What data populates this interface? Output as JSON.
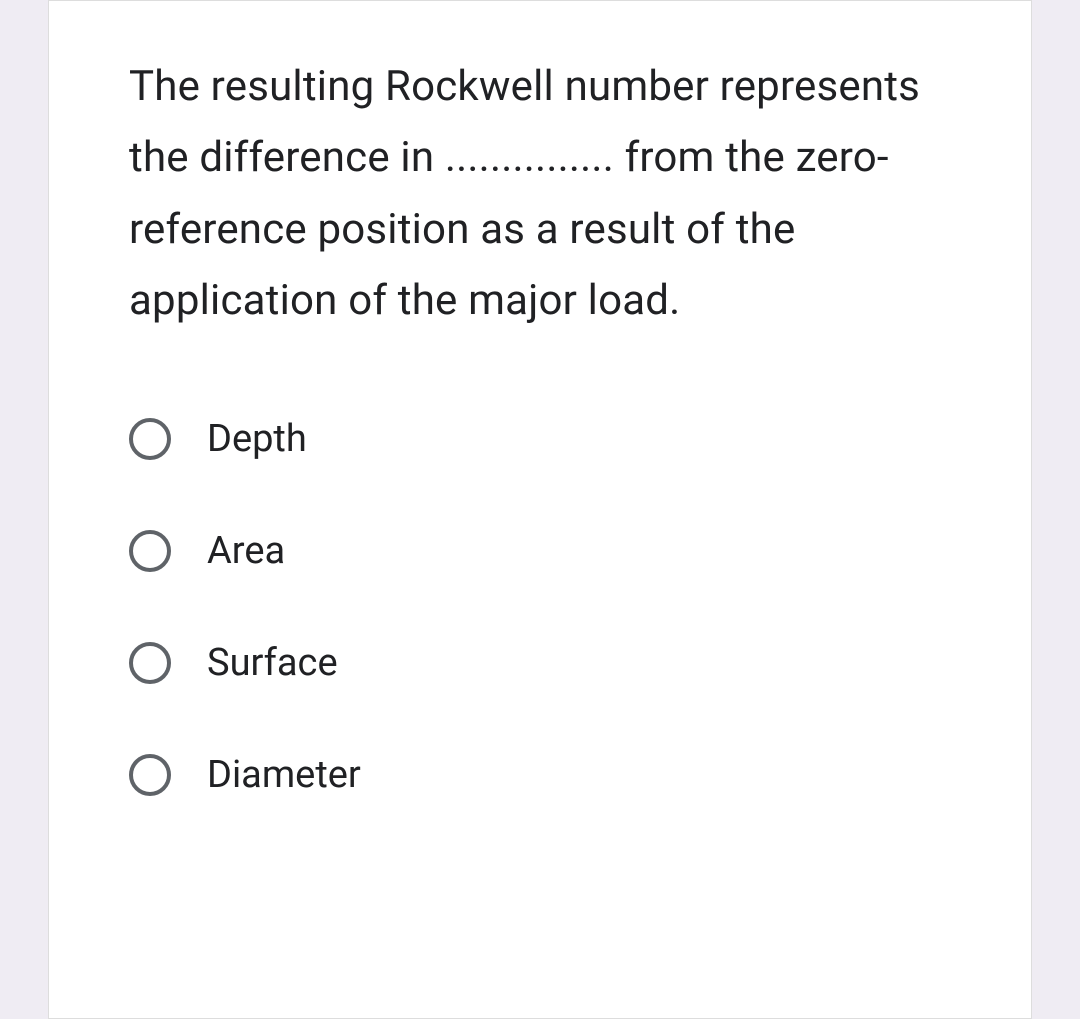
{
  "question": {
    "text": "The resulting Rockwell number represents the difference in ............... from the zero-reference position as a result of the application of the major load."
  },
  "options": [
    {
      "label": "Depth"
    },
    {
      "label": "Area"
    },
    {
      "label": "Surface"
    },
    {
      "label": "Diameter"
    }
  ]
}
